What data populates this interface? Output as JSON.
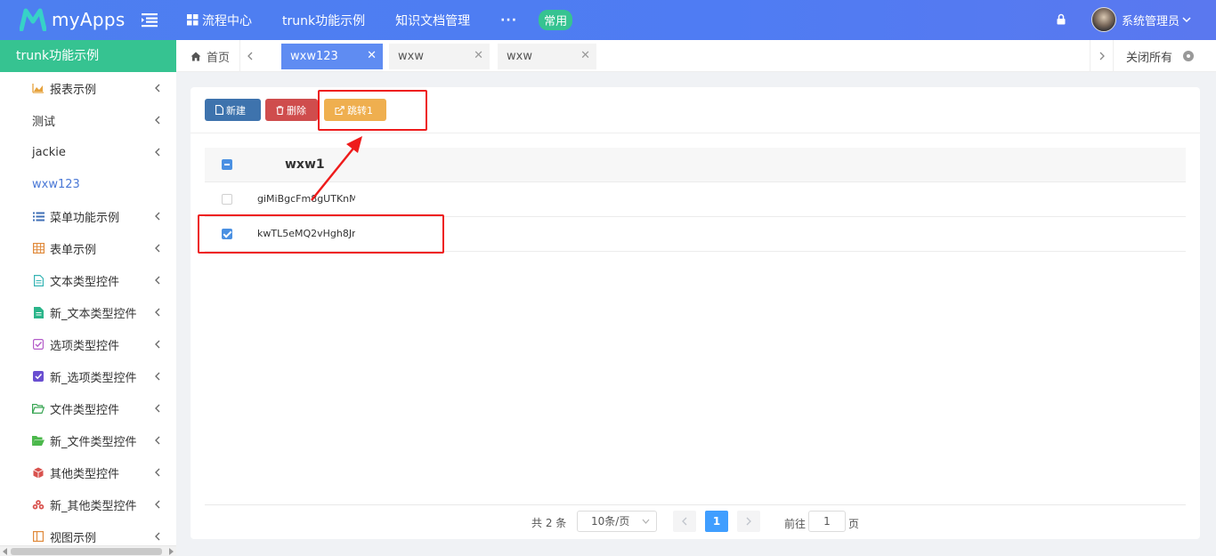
{
  "app": {
    "name": "myApps"
  },
  "topnav": {
    "items": [
      {
        "label": "流程中心",
        "icon": "grid-icon"
      },
      {
        "label": "trunk功能示例"
      },
      {
        "label": "知识文档管理"
      }
    ],
    "more_label": "···",
    "pill_label": "常用"
  },
  "user": {
    "name": "系统管理员"
  },
  "sidebar": {
    "title": "trunk功能示例",
    "items": [
      {
        "label": "报表示例",
        "icon": "chart-icon",
        "color": "#e6a23c"
      },
      {
        "label": "测试"
      },
      {
        "label": "jackie"
      },
      {
        "label": "wxw123"
      },
      {
        "label": "菜单功能示例",
        "icon": "list-icon",
        "color": "#3f6fb6"
      },
      {
        "label": "表单示例",
        "icon": "table-icon",
        "color": "#e08a3c"
      },
      {
        "label": "文本类型控件",
        "icon": "doc-icon",
        "color": "#36b4b4"
      },
      {
        "label": "新_文本类型控件",
        "icon": "doc-fill-icon",
        "color": "#2bb58a"
      },
      {
        "label": "选项类型控件",
        "icon": "checkbox-icon",
        "color": "#b45cc9"
      },
      {
        "label": "新_选项类型控件",
        "icon": "checkbox-fill-icon",
        "color": "#6a4fd1"
      },
      {
        "label": "文件类型控件",
        "icon": "folder-open-icon",
        "color": "#3aa655"
      },
      {
        "label": "新_文件类型控件",
        "icon": "folder-fill-icon",
        "color": "#4cb84c"
      },
      {
        "label": "其他类型控件",
        "icon": "cube-icon",
        "color": "#d9534f"
      },
      {
        "label": "新_其他类型控件",
        "icon": "cubes-icon",
        "color": "#d9534f"
      },
      {
        "label": "视图示例",
        "icon": "view-icon",
        "color": "#e08a3c"
      }
    ]
  },
  "tabs": {
    "home_label": "首页",
    "items": [
      {
        "label": "wxw123",
        "active": true
      },
      {
        "label": "wxw",
        "active": false
      },
      {
        "label": "wxw",
        "active": false
      }
    ],
    "close_all_label": "关闭所有"
  },
  "toolbar": {
    "new_label": "新建",
    "delete_label": "删除",
    "jump_label": "跳转1"
  },
  "table": {
    "column": "wxw1",
    "rows": [
      {
        "value": "giMiBgcFm8gUTKnM",
        "checked": false
      },
      {
        "value": "kwTL5eMQ2vHgh8Jn",
        "checked": true
      }
    ]
  },
  "pagination": {
    "total_text": "共 2 条",
    "page_size": "10条/页",
    "current_page": "1",
    "goto_label": "前往",
    "goto_value": "1",
    "goto_suffix": "页"
  },
  "colors": {
    "topbar": "#4f7cf3",
    "sidebar_title": "#36c391",
    "active_tab": "#5f8cf2",
    "annotation": "#ee1b1b"
  }
}
